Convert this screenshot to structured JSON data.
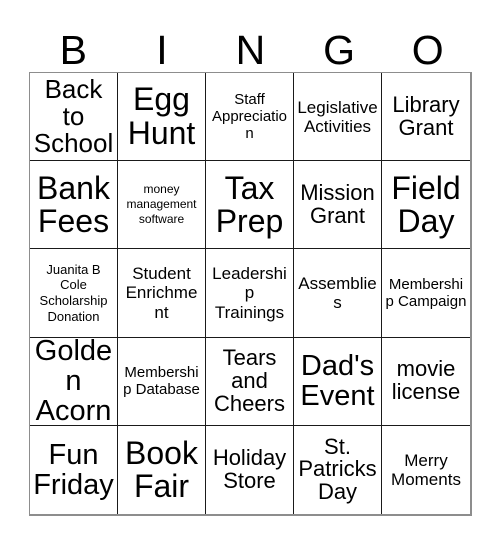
{
  "card": {
    "header_letters": [
      "B",
      "I",
      "N",
      "G",
      "O"
    ],
    "grid": {
      "rows": 5,
      "columns": 5,
      "cells": [
        {
          "text": "Back to School",
          "size": "lg"
        },
        {
          "text": "Egg Hunt",
          "size": "xxl"
        },
        {
          "text": "Staff Appreciation",
          "size": "xs"
        },
        {
          "text": "Legislative Activities",
          "size": "sm"
        },
        {
          "text": "Library Grant",
          "size": "md"
        },
        {
          "text": "Bank Fees",
          "size": "xxl"
        },
        {
          "text": "money management software",
          "size": "tiny"
        },
        {
          "text": "Tax Prep",
          "size": "xxl"
        },
        {
          "text": "Mission Grant",
          "size": "md"
        },
        {
          "text": "Field Day",
          "size": "xxl"
        },
        {
          "text": "Juanita B Cole Scholarship Donation",
          "size": "xxs"
        },
        {
          "text": "Student Enrichment",
          "size": "sm"
        },
        {
          "text": "Leadership Trainings",
          "size": "sm"
        },
        {
          "text": "Assemblies",
          "size": "sm"
        },
        {
          "text": "Membership Campaign",
          "size": "xs"
        },
        {
          "text": "Golden Acorn",
          "size": "xl"
        },
        {
          "text": "Membership Database",
          "size": "xs"
        },
        {
          "text": "Tears and Cheers",
          "size": "md"
        },
        {
          "text": "Dad's Event",
          "size": "xl"
        },
        {
          "text": "movie license",
          "size": "md"
        },
        {
          "text": "Fun Friday",
          "size": "xl"
        },
        {
          "text": "Book Fair",
          "size": "xxl"
        },
        {
          "text": "Holiday Store",
          "size": "md"
        },
        {
          "text": "St. Patricks Day",
          "size": "md"
        },
        {
          "text": "Merry Moments",
          "size": "sm"
        }
      ]
    },
    "colors": {
      "background": "#ffffff",
      "text": "#000000",
      "grid_line": "#1a1a1a",
      "outer_frame": "#8d8d8d"
    }
  }
}
